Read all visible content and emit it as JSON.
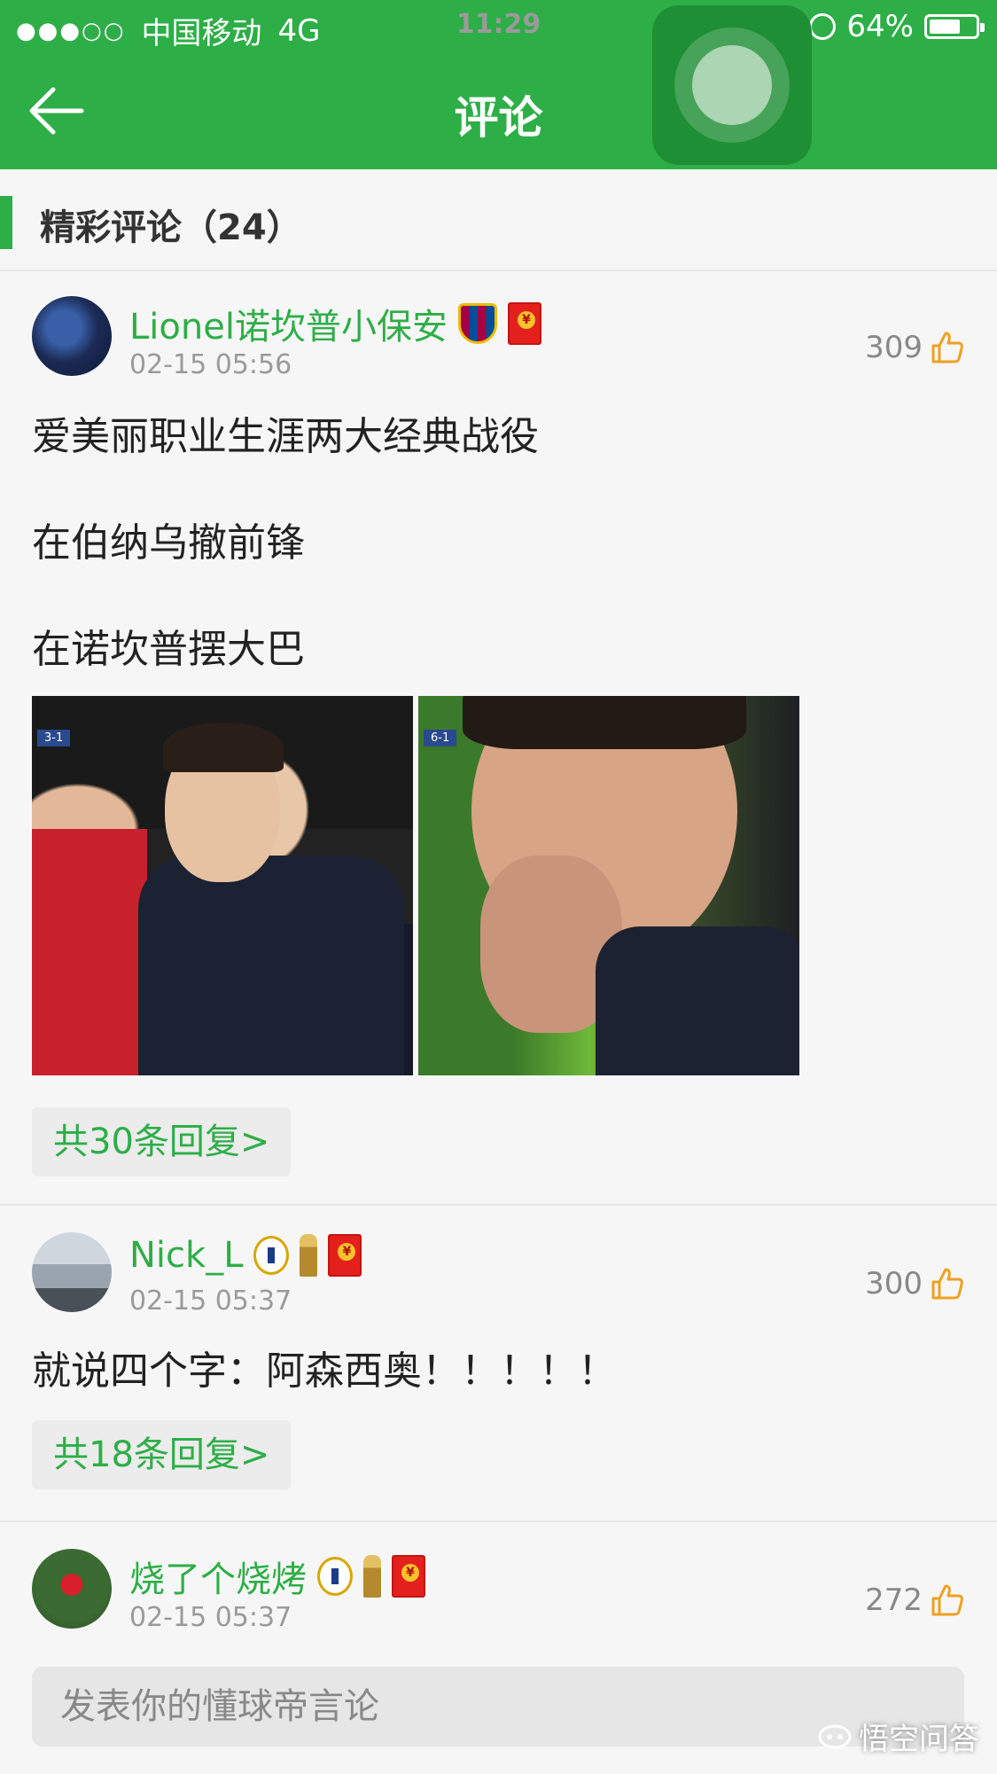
{
  "status_bar": {
    "signal": "●●●○○",
    "carrier": "中国移动",
    "network": "4G",
    "time": "11:29",
    "battery": "64%"
  },
  "header": {
    "title": "评论"
  },
  "section": {
    "title": "精彩评论（24）"
  },
  "comments": [
    {
      "username": "Lionel诺坎普小保安",
      "time": "02-15 05:56",
      "likes": "309",
      "lines": [
        "爱美丽职业生涯两大经典战役",
        "在伯纳乌撤前锋",
        "在诺坎普摆大巴"
      ],
      "images": [
        {
          "score": "3-1"
        },
        {
          "score": "6-1"
        }
      ],
      "replies": "共30条回复>"
    },
    {
      "username": "Nick_L",
      "time": "02-15 05:37",
      "likes": "300",
      "lines": [
        "就说四个字：阿森西奥！！！！！"
      ],
      "replies": "共18条回复>"
    },
    {
      "username": "烧了个烧烤",
      "time": "02-15 05:37",
      "likes": "272"
    }
  ],
  "input": {
    "placeholder": "发表你的懂球帝言论"
  },
  "watermark": {
    "text": "悟空问答"
  },
  "colors": {
    "brand_green": "#2dae47",
    "like_orange": "#f0a020"
  }
}
